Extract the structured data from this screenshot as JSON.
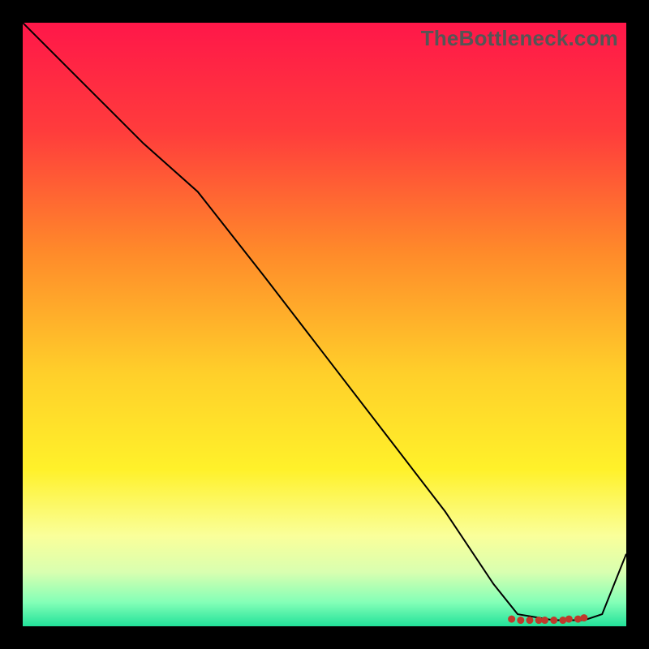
{
  "watermark": "TheBottleneck.com",
  "chart_data": {
    "type": "line",
    "title": "",
    "xlabel": "",
    "ylabel": "",
    "xlim": [
      0,
      100
    ],
    "ylim": [
      0,
      100
    ],
    "grid": false,
    "legend": false,
    "background": {
      "type": "vertical-gradient",
      "stops": [
        {
          "pos": 0,
          "color": "#ff1749"
        },
        {
          "pos": 18,
          "color": "#ff3c3c"
        },
        {
          "pos": 38,
          "color": "#ff8a2a"
        },
        {
          "pos": 58,
          "color": "#ffcf2a"
        },
        {
          "pos": 74,
          "color": "#fff12a"
        },
        {
          "pos": 85,
          "color": "#faff9a"
        },
        {
          "pos": 91,
          "color": "#d9ffb0"
        },
        {
          "pos": 96,
          "color": "#84ffb7"
        },
        {
          "pos": 100,
          "color": "#22e29a"
        }
      ]
    },
    "series": [
      {
        "name": "bottleneck-curve",
        "color": "#000000",
        "stroke_width": 2,
        "x": [
          0,
          10,
          20,
          29,
          40,
          50,
          60,
          70,
          78,
          82,
          88,
          93,
          96,
          100
        ],
        "y": [
          100,
          90,
          80,
          72,
          58,
          45,
          32,
          19,
          7,
          2,
          1,
          1,
          2,
          12
        ]
      }
    ],
    "markers": {
      "name": "bottom-cluster",
      "color": "#c0392b",
      "x": [
        81,
        82.5,
        84,
        85.5,
        86.5,
        88,
        89.5,
        90.5,
        92,
        93
      ],
      "y": [
        1.2,
        1.0,
        1.0,
        1.0,
        1.0,
        1.0,
        1.0,
        1.2,
        1.2,
        1.4
      ]
    }
  }
}
